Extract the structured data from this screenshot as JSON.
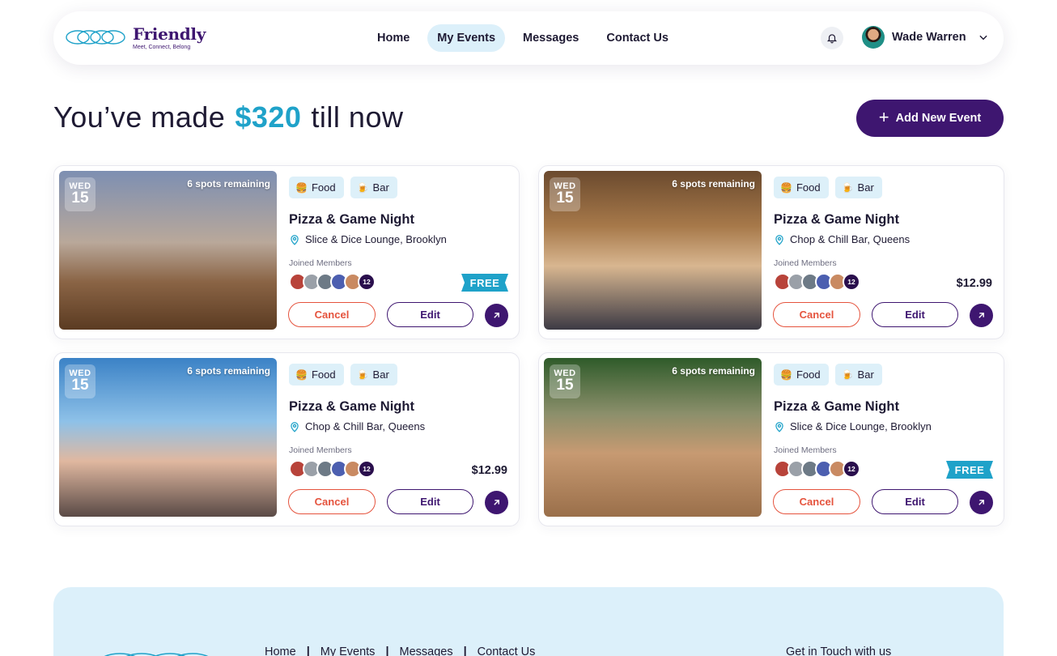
{
  "brand": {
    "name": "Friendly",
    "tagline": "Meet, Connect, Belong"
  },
  "nav": {
    "links": [
      "Home",
      "My Events",
      "Messages",
      "Contact Us"
    ],
    "active": "My Events"
  },
  "user": {
    "name": "Wade Warren"
  },
  "headline": {
    "prefix": "You’ve made",
    "amount": "$320",
    "suffix": "till now"
  },
  "add_event_label": "Add New Event",
  "events": [
    {
      "dow": "WED",
      "day": "15",
      "spots": "6 spots remaining",
      "tags": [
        "Food",
        "Bar"
      ],
      "title": "Pizza & Game Night",
      "location": "Slice & Dice Lounge, Brooklyn",
      "joined_label": "Joined Members",
      "member_count": "12",
      "price": "FREE",
      "is_free": true,
      "cancel": "Cancel",
      "edit": "Edit"
    },
    {
      "dow": "WED",
      "day": "15",
      "spots": "6 spots remaining",
      "tags": [
        "Food",
        "Bar"
      ],
      "title": "Pizza & Game Night",
      "location": "Chop & Chill Bar, Queens",
      "joined_label": "Joined Members",
      "member_count": "12",
      "price": "$12.99",
      "is_free": false,
      "cancel": "Cancel",
      "edit": "Edit"
    },
    {
      "dow": "WED",
      "day": "15",
      "spots": "6 spots remaining",
      "tags": [
        "Food",
        "Bar"
      ],
      "title": "Pizza & Game Night",
      "location": "Chop & Chill Bar, Queens",
      "joined_label": "Joined Members",
      "member_count": "12",
      "price": "$12.99",
      "is_free": false,
      "cancel": "Cancel",
      "edit": "Edit"
    },
    {
      "dow": "WED",
      "day": "15",
      "spots": "6 spots remaining",
      "tags": [
        "Food",
        "Bar"
      ],
      "title": "Pizza & Game Night",
      "location": "Slice & Dice Lounge, Brooklyn",
      "joined_label": "Joined Members",
      "member_count": "12",
      "price": "FREE",
      "is_free": true,
      "cancel": "Cancel",
      "edit": "Edit"
    }
  ],
  "footer": {
    "links": [
      "Home",
      "My Events",
      "Messages",
      "Contact Us"
    ],
    "contact_heading": "Get in Touch with us"
  },
  "colors": {
    "primary": "#3e1670",
    "accent": "#1fa2c9",
    "cancel": "#e5533d",
    "tag_bg": "#ddf0f9",
    "footer_bg": "#dcf0fa"
  }
}
